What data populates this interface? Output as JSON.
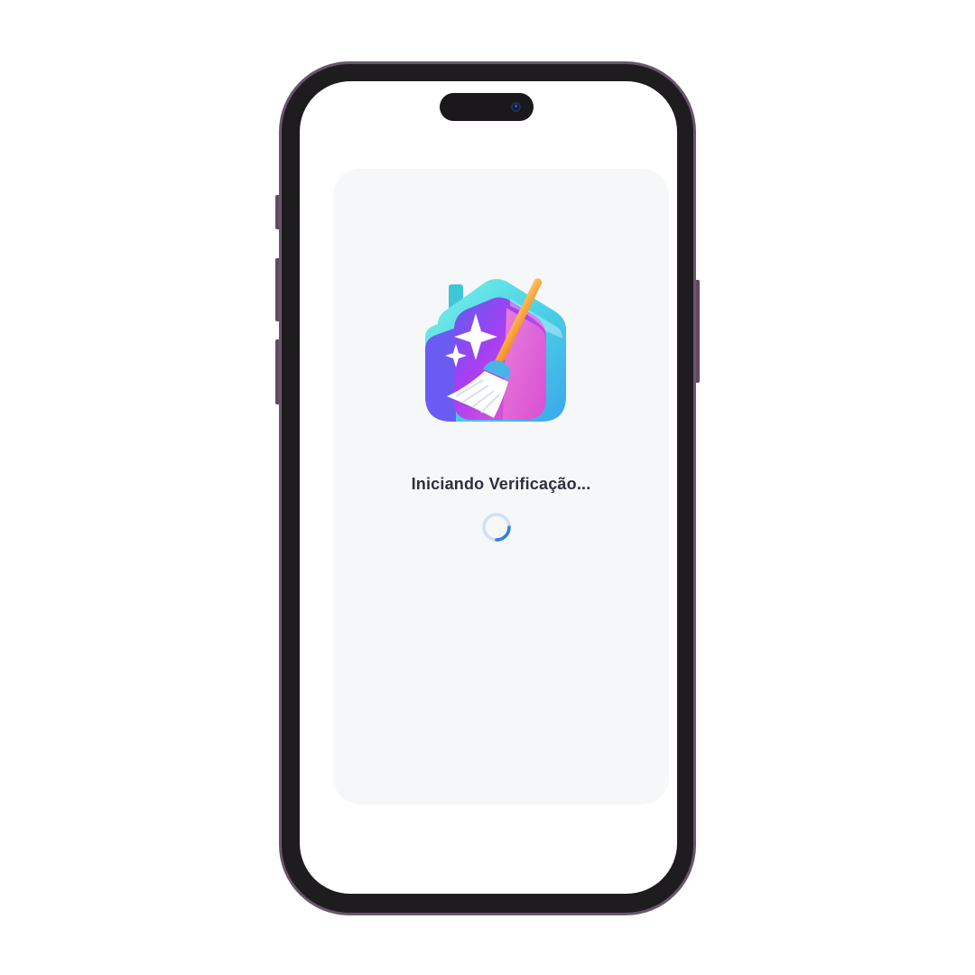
{
  "screen": {
    "status_text": "Iniciando Verificação...",
    "logo_icon": "house-broom-icon",
    "loading_icon": "loading-spinner-icon"
  },
  "colors": {
    "frame": "#6b556c",
    "bezel": "#1e1c1f",
    "card_background": "#f6f7f9",
    "text": "#2b313c",
    "spinner_track": "#cfe0f7",
    "spinner_arc": "#2f7ee6",
    "logo_cyan": "#4de3e0",
    "logo_purple": "#8a3df0",
    "logo_pink": "#f05fc0",
    "broom_handle": "#f5a623"
  }
}
